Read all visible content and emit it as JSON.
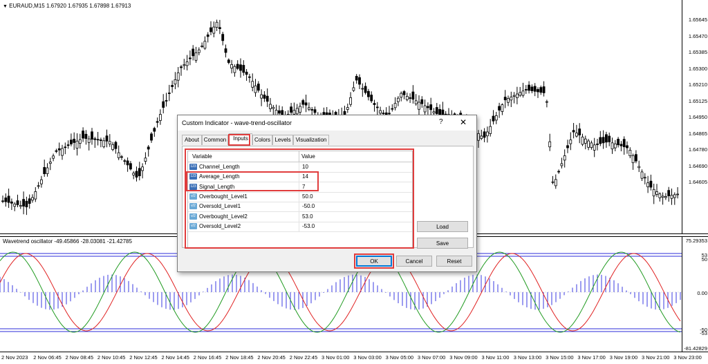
{
  "chart": {
    "title": "EURAUD,M15",
    "ohlc": "1.67920 1.67935 1.67898 1.67913",
    "price_labels": [
      "1.65645",
      "1.65470",
      "1.65385",
      "1.65300",
      "1.65210",
      "1.65125",
      "1.64950",
      "1.64865",
      "1.64780",
      "1.64690",
      "1.64605"
    ],
    "indicator_title": "Wavetrend oscillator -49.45866 -28.03081 -21.42785",
    "indicator_labels": [
      "75.29353",
      "53",
      "50",
      "0.00",
      "-50",
      "-53",
      "-81.42829"
    ],
    "time_labels": [
      "2 Nov 2023",
      "2 Nov 06:45",
      "2 Nov 08:45",
      "2 Nov 10:45",
      "2 Nov 12:45",
      "2 Nov 14:45",
      "2 Nov 16:45",
      "2 Nov 18:45",
      "2 Nov 20:45",
      "2 Nov 22:45",
      "3 Nov 01:00",
      "3 Nov 03:00",
      "3 Nov 05:00",
      "3 Nov 07:00",
      "3 Nov 09:00",
      "3 Nov 11:00",
      "3 Nov 13:00",
      "3 Nov 15:00",
      "3 Nov 17:00",
      "3 Nov 19:00",
      "3 Nov 21:00",
      "3 Nov 23:00"
    ],
    "colors": {
      "up_candle": "#ffffff",
      "down_candle": "#000000",
      "wt1": "#1f9a1f",
      "wt2": "#e02020",
      "histogram": "#3a3ae0",
      "level_lines": "#2b2bd8"
    }
  },
  "dialog": {
    "title": "Custom Indicator - wave-trend-oscillator",
    "help": "?",
    "close": "✕",
    "tabs": [
      "About",
      "Common",
      "Inputs",
      "Colors",
      "Levels",
      "Visualization"
    ],
    "active_tab": "Inputs",
    "columns": {
      "variable": "Variable",
      "value": "Value"
    },
    "rows": [
      {
        "icon": "int",
        "name": "Channel_Length",
        "value": "10"
      },
      {
        "icon": "int",
        "name": "Average_Length",
        "value": "14"
      },
      {
        "icon": "int",
        "name": "Signal_Length",
        "value": "7"
      },
      {
        "icon": "dbl",
        "name": "Overbought_Level1",
        "value": "50.0"
      },
      {
        "icon": "dbl",
        "name": "Oversold_Level1",
        "value": "-50.0"
      },
      {
        "icon": "dbl",
        "name": "Overbought_Level2",
        "value": "53.0"
      },
      {
        "icon": "dbl",
        "name": "Oversold_Level2",
        "value": "-53.0"
      }
    ],
    "buttons": {
      "load": "Load",
      "save": "Save",
      "ok": "OK",
      "cancel": "Cancel",
      "reset": "Reset"
    },
    "highlight_color": "#e03c3c"
  }
}
